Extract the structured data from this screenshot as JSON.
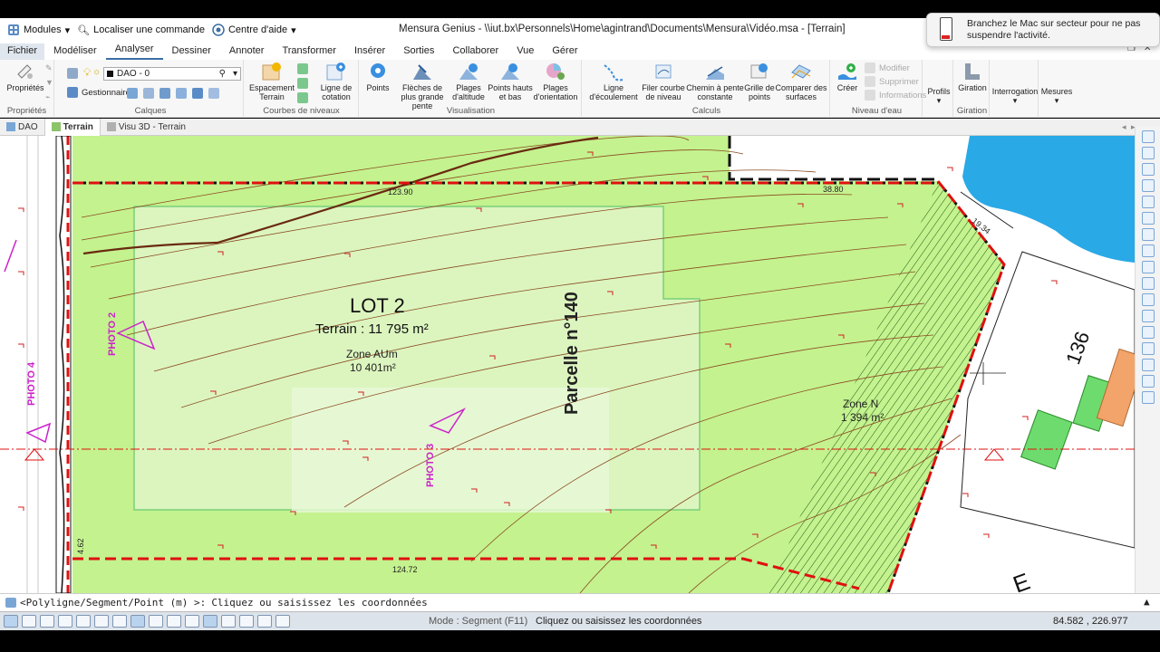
{
  "titlebar": {
    "modules": "Modules",
    "search": "Localiser une commande",
    "help": "Centre d'aide",
    "title": "Mensura Genius - \\\\iut.bx\\Personnels\\Home\\agintrand\\Documents\\Mensura\\Vidéo.msa - [Terrain]"
  },
  "notification": {
    "text": "Branchez le Mac sur secteur pour ne pas suspendre l'activité."
  },
  "menu": {
    "tabs": [
      "Fichier",
      "Modéliser",
      "Analyser",
      "Dessiner",
      "Annoter",
      "Transformer",
      "Insérer",
      "Sorties",
      "Collaborer",
      "Vue",
      "Gérer"
    ]
  },
  "ribbon": {
    "proprietes": {
      "label": "Propriétés",
      "group": "Propriétés"
    },
    "calques": {
      "layer": "DAO - 0",
      "manager": "Gestionnaire",
      "group": "Calques"
    },
    "courbes": {
      "espacement": "Espacement Terrain",
      "ligne_cotation": "Ligne de cotation",
      "group": "Courbes de niveaux"
    },
    "visualisation": {
      "points": "Points",
      "fleches": "Flèches de plus grande pente",
      "plages_altitude": "Plages d'altitude",
      "points_hauts": "Points hauts et bas",
      "plages_orientation": "Plages d'orientation",
      "group": "Visualisation"
    },
    "calculs": {
      "ligne_ecoulement": "Ligne d'écoulement",
      "filer_courbe": "Filer courbe de niveau",
      "chemin_pente": "Chemin à pente constante",
      "grille_points": "Grille de points",
      "comparer_surfaces": "Comparer des surfaces",
      "group": "Calculs"
    },
    "niveau_eau": {
      "creer": "Créer",
      "modifier": "Modifier",
      "supprimer": "Supprimer",
      "informations": "Informations",
      "group": "Niveau d'eau"
    },
    "profils": "Profils",
    "giration": {
      "label": "Giration",
      "group": "Giration"
    },
    "interrogation": "Interrogation",
    "mesures": "Mesures"
  },
  "doctabs": [
    "DAO",
    "Terrain",
    "Visu 3D - Terrain"
  ],
  "drawing": {
    "lot_title": "LOT 2",
    "terrain_area": "Terrain : 11 795 m²",
    "zone_aum": "Zone AUm",
    "zone_aum_area": "10 401m²",
    "parcelle": "Parcelle n°140",
    "zone_n": "Zone N",
    "zone_n_area": "1 394 m²",
    "parcel_136": "136",
    "photo2": "PHOTO 2",
    "photo3": "PHOTO 3",
    "photo4": "PHOTO 4",
    "dim_top": "123.90",
    "dim_top_right": "38.80",
    "dim_bottom": "124.72",
    "dim_right": "19.34",
    "dim_left": "4.62",
    "letter_e": "E",
    "colors": {
      "terrain": "#c4f28e",
      "zone_aum": "#dcf5bf",
      "water": "#29a9e6",
      "boundary_red": "#e01010",
      "photo_magenta": "#cc22cc",
      "contour": "#7a3d1a"
    }
  },
  "cmdline": {
    "prompt": "<Polyligne/Segment/Point (m) >:",
    "value": "Cliquez ou saisissez les coordonnées"
  },
  "statusbar": {
    "mode": "Mode : Segment (F11)",
    "message": "Cliquez ou saisissez les coordonnées",
    "coords": "84.582 , 226.977"
  }
}
